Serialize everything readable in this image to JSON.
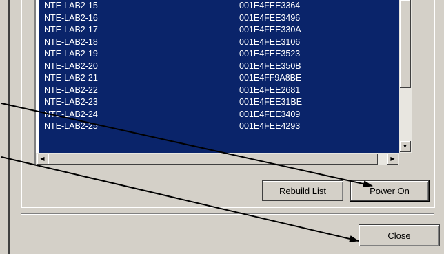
{
  "devices": [
    {
      "name": "NTE-LAB2-15",
      "mac": "001E4FEE3364"
    },
    {
      "name": "NTE-LAB2-16",
      "mac": "001E4FEE3496"
    },
    {
      "name": "NTE-LAB2-17",
      "mac": "001E4FEE330A"
    },
    {
      "name": "NTE-LAB2-18",
      "mac": "001E4FEE3106"
    },
    {
      "name": "NTE-LAB2-19",
      "mac": "001E4FEE3523"
    },
    {
      "name": "NTE-LAB2-20",
      "mac": "001E4FEE350B"
    },
    {
      "name": "NTE-LAB2-21",
      "mac": "001E4FF9A8BE"
    },
    {
      "name": "NTE-LAB2-22",
      "mac": "001E4FEE2681"
    },
    {
      "name": "NTE-LAB2-23",
      "mac": "001E4FEE31BE"
    },
    {
      "name": "NTE-LAB2-24",
      "mac": "001E4FEE3409"
    },
    {
      "name": "NTE-LAB2-25",
      "mac": "001E4FEE4293"
    }
  ],
  "buttons": {
    "rebuild": "Rebuild List",
    "power_on": "Power On",
    "close": "Close"
  },
  "icons": {
    "scroll_up": "arrow-up",
    "scroll_down": "arrow-down",
    "scroll_left": "arrow-left",
    "scroll_right": "arrow-right"
  },
  "colors": {
    "selection": "#0a246a",
    "selection_text": "#ffffff",
    "face": "#d4d0c8",
    "annotation_arrow": "#000000"
  }
}
